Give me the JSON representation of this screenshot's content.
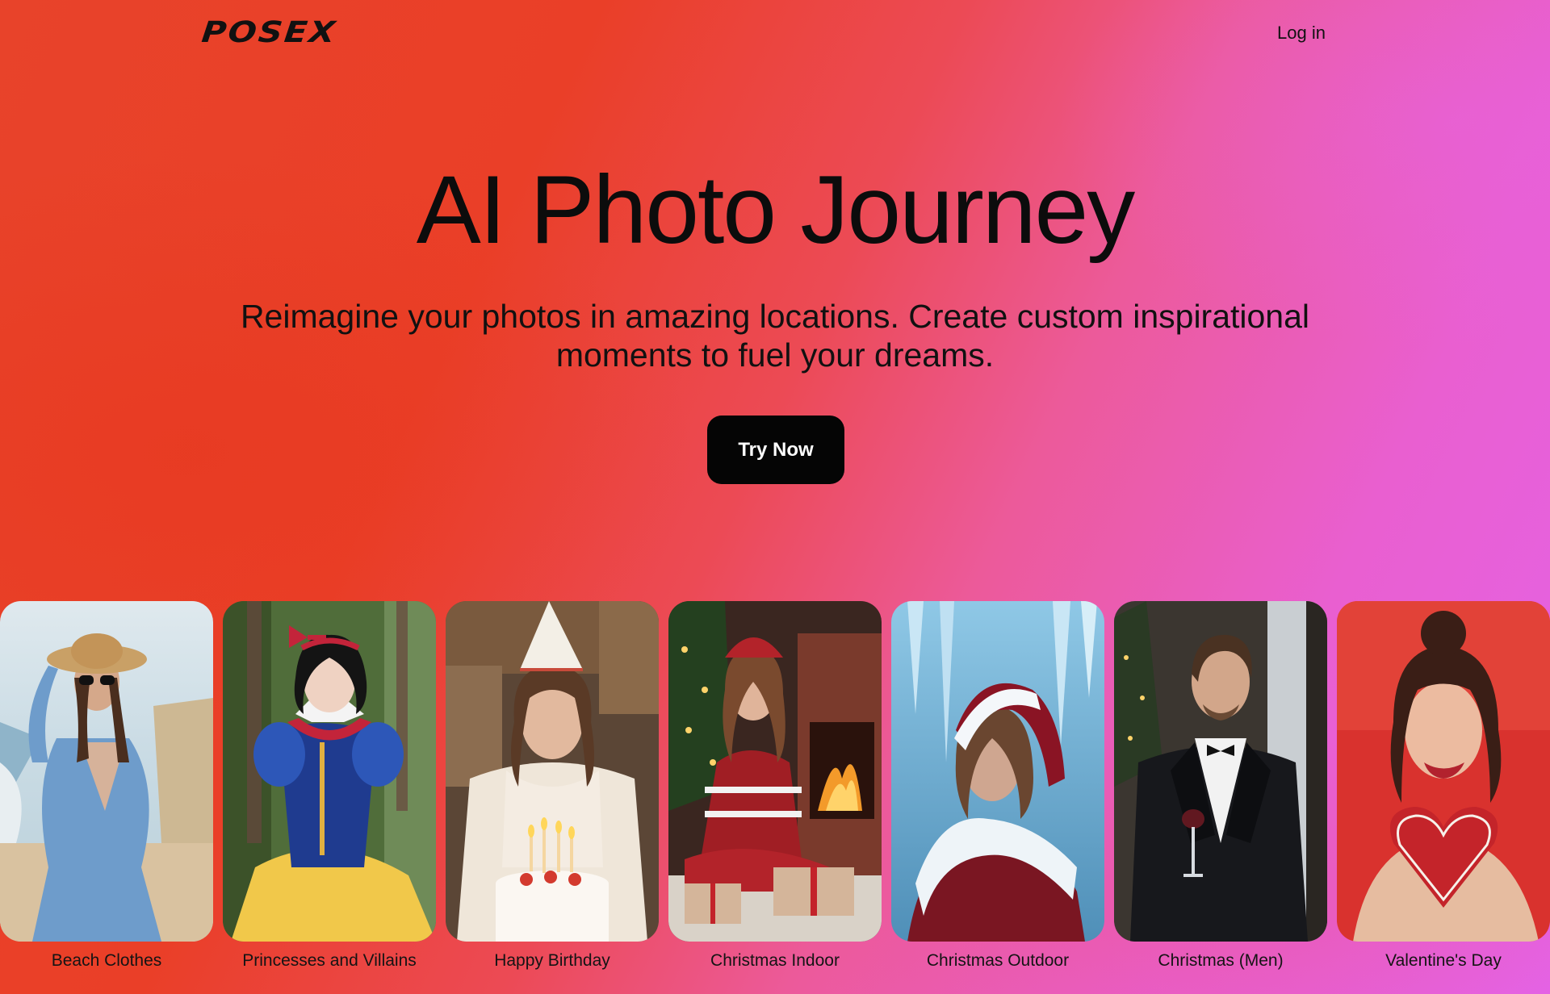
{
  "brand": {
    "logo": "POSEX"
  },
  "nav": {
    "login_label": "Log in"
  },
  "hero": {
    "title": "AI Photo Journey",
    "subtitle_line1": "Reimagine your photos in amazing locations. Create custom inspirational",
    "subtitle_line2": "moments to fuel your dreams.",
    "cta_label": "Try Now"
  },
  "colors": {
    "gradient_start": "#e8432a",
    "gradient_end": "#e463e8",
    "cta_background": "#050505"
  },
  "gallery": {
    "cards": [
      {
        "label": "Beach Clothes"
      },
      {
        "label": "Princesses and Villains"
      },
      {
        "label": "Happy Birthday"
      },
      {
        "label": "Christmas Indoor"
      },
      {
        "label": "Christmas Outdoor"
      },
      {
        "label": "Christmas (Men)"
      },
      {
        "label": "Valentine's Day"
      }
    ]
  }
}
